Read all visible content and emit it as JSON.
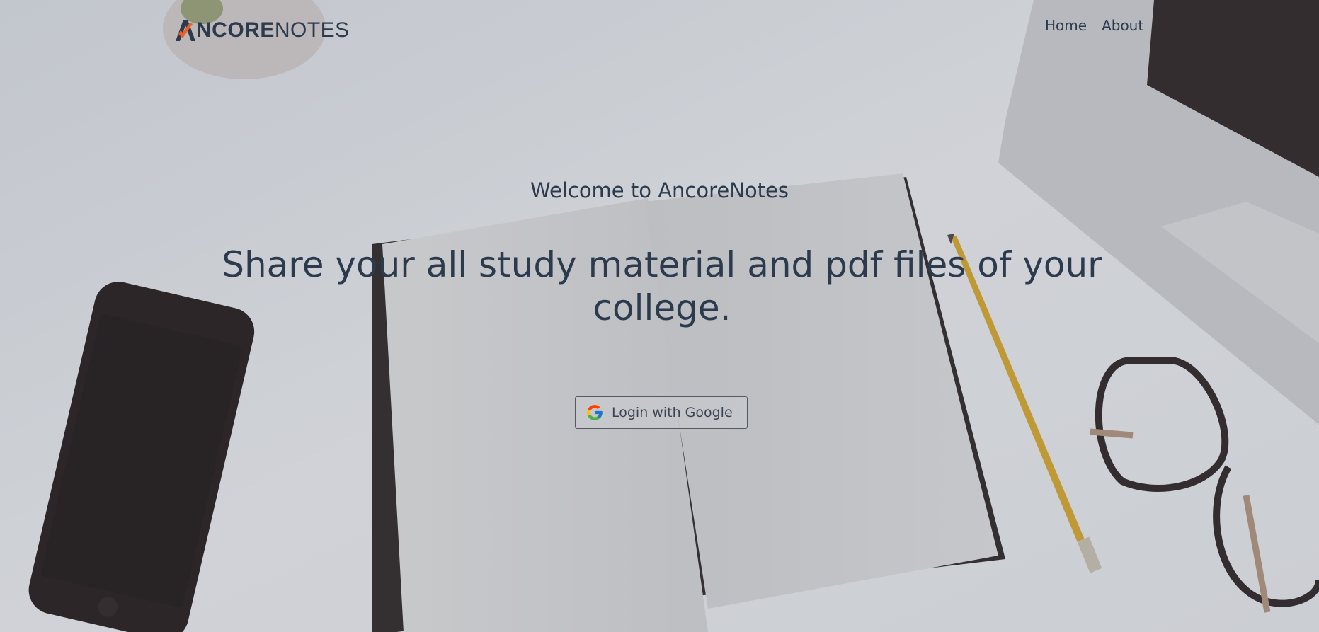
{
  "header": {
    "logo_strong": "NCORE",
    "logo_thin": "NOTES",
    "nav": [
      {
        "label": "Home"
      },
      {
        "label": "About"
      }
    ]
  },
  "hero": {
    "welcome": "Welcome to AncoreNotes",
    "headline": "Share your all study material and pdf files of your college.",
    "login_label": "Login with Google"
  },
  "icons": {
    "google": "google-icon",
    "logo": "ancorenotes-logo"
  },
  "colors": {
    "text": "#2c3a4d",
    "accent": "#e8612c"
  }
}
